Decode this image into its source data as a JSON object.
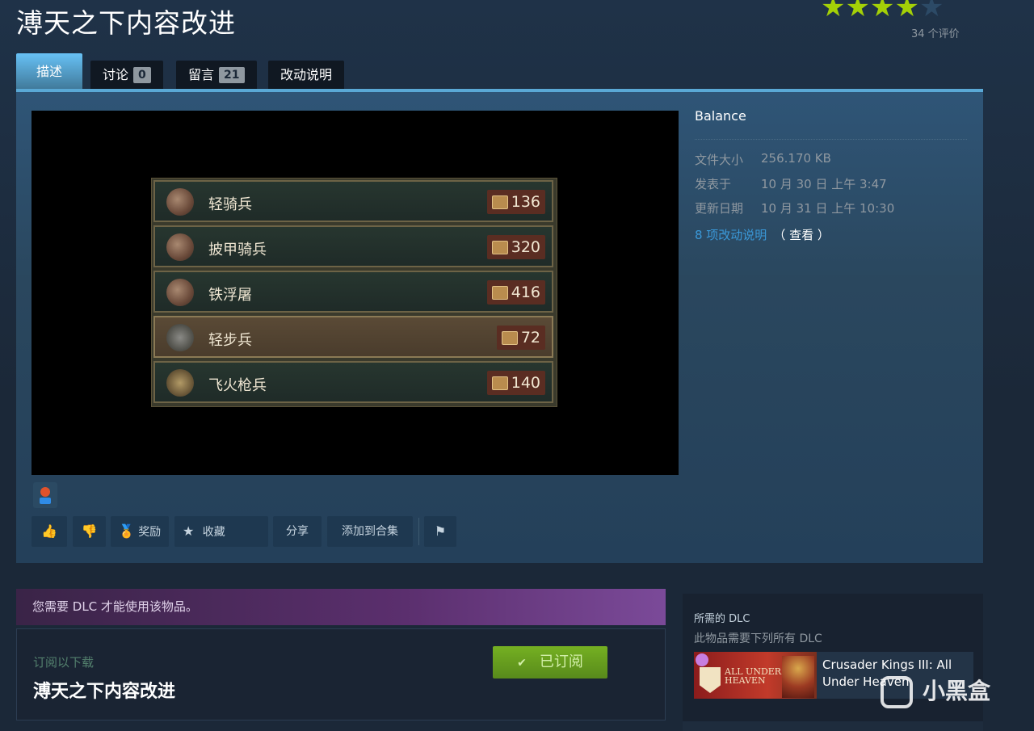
{
  "item": {
    "title": "溥天之下内容改进",
    "rating": {
      "stars_filled": 4,
      "stars_total": 5,
      "count_text": "34 个评价"
    }
  },
  "tabs": [
    {
      "label": "描述",
      "active": true
    },
    {
      "label": "讨论",
      "count": "0"
    },
    {
      "label": "留言",
      "count": "21"
    },
    {
      "label": "改动说明"
    }
  ],
  "media": {
    "units": [
      {
        "name": "轻骑兵",
        "cost": "136",
        "selected": false
      },
      {
        "name": "披甲骑兵",
        "cost": "320",
        "selected": false
      },
      {
        "name": "铁浮屠",
        "cost": "416",
        "selected": false
      },
      {
        "name": "轻步兵",
        "cost": "72",
        "selected": true
      },
      {
        "name": "飞火枪兵",
        "cost": "140",
        "selected": false
      }
    ]
  },
  "meta": {
    "tag": "Balance",
    "file_size_label": "文件大小",
    "file_size": "256.170 KB",
    "posted_label": "发表于",
    "posted": "10 月 30 日 上午 3:47",
    "updated_label": "更新日期",
    "updated": "10 月 31 日 上午 10:30",
    "changes_link": "8 项改动说明",
    "changes_view": "（ 查看 ）"
  },
  "actions": {
    "award": "奖励",
    "favorite": "收藏",
    "share": "分享",
    "add_to_collection": "添加到合集"
  },
  "dlc_notice": "您需要 DLC 才能使用该物品。",
  "subscribe": {
    "hint": "订阅以下载",
    "title": "溥天之下内容改进",
    "button": "已订阅"
  },
  "required_dlc": {
    "title": "所需的 DLC",
    "subtitle": "此物品需要下列所有 DLC",
    "thumb_line1": "ALL UNDER",
    "thumb_line2": "HEAVEN",
    "name": "Crusader Kings III: All Under Heaven"
  },
  "watermark": "小黑盒",
  "colors": {
    "accent": "#67c1f5",
    "subscribed_green": "#75b022",
    "dlc_purple": "#7b4a99"
  }
}
